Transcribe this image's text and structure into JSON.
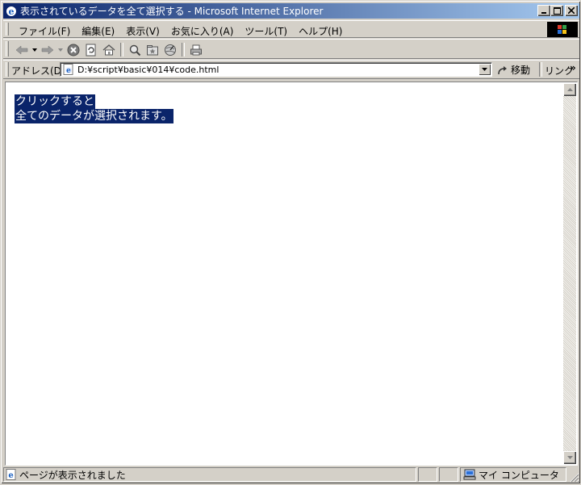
{
  "window": {
    "title": "表示されているデータを全て選択する - Microsoft Internet Explorer"
  },
  "menubar": {
    "items": [
      {
        "label": "ファイル(F)"
      },
      {
        "label": "編集(E)"
      },
      {
        "label": "表示(V)"
      },
      {
        "label": "お気に入り(A)"
      },
      {
        "label": "ツール(T)"
      },
      {
        "label": "ヘルプ(H)"
      }
    ]
  },
  "toolbar": {
    "icons": [
      "back-icon",
      "forward-icon",
      "stop-icon",
      "refresh-icon",
      "home-icon",
      "search-icon",
      "favorites-icon",
      "history-icon",
      "print-icon"
    ]
  },
  "addressbar": {
    "label": "アドレス(D)",
    "url": "D:¥script¥basic¥014¥code.html",
    "go_label": "移動",
    "links_label": "リンク",
    "links_more": "»"
  },
  "content": {
    "lines": [
      "クリックすると",
      "全てのデータが選択されます。"
    ],
    "selection_color": "#0a246a"
  },
  "statusbar": {
    "message": "ページが表示されました",
    "zone": "マイ コンピュータ"
  }
}
